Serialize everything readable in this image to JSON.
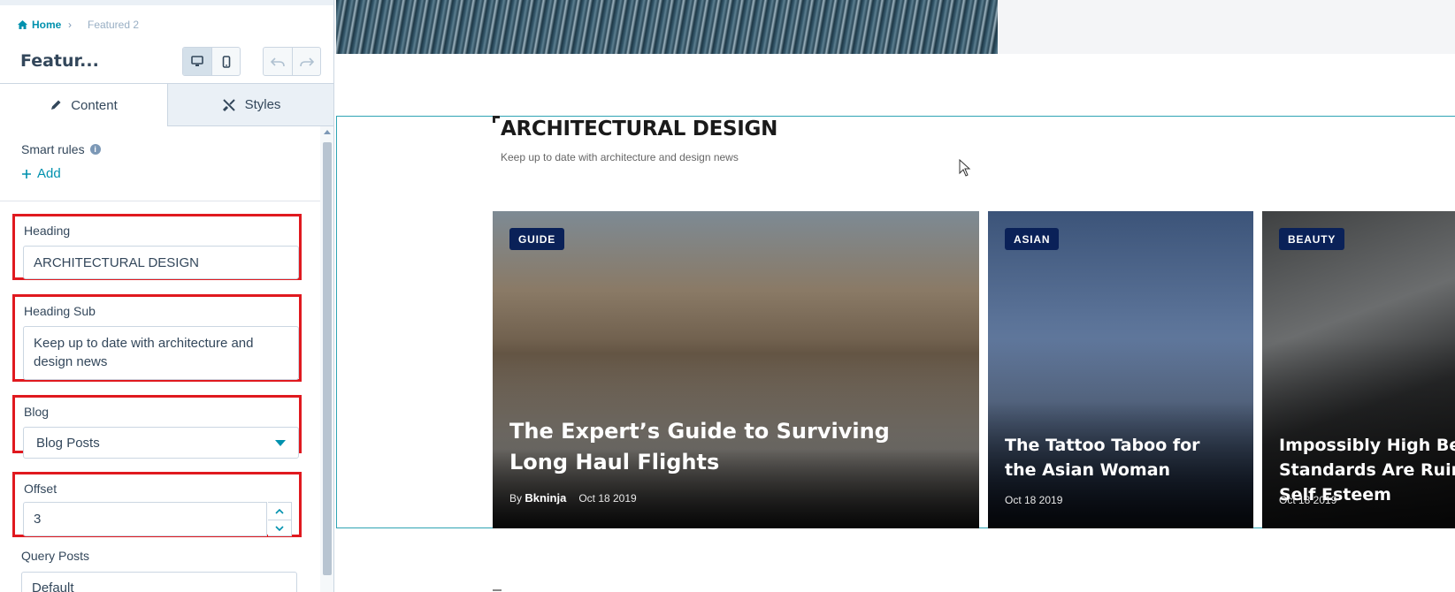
{
  "breadcrumb": {
    "home": "Home",
    "separator": "›",
    "current": "Featured 2"
  },
  "module_title": "Featur...",
  "toolbar": {
    "desktop_icon": "desktop-icon",
    "mobile_icon": "mobile-icon",
    "undo_icon": "undo-icon",
    "redo_icon": "redo-icon"
  },
  "tabs": [
    {
      "label": "Content",
      "icon": "pencil-icon",
      "active": true
    },
    {
      "label": "Styles",
      "icon": "brush-icon",
      "active": false
    }
  ],
  "smart_rules": {
    "label": "Smart rules",
    "info": "i",
    "add_label": "Add"
  },
  "fields": {
    "heading": {
      "label": "Heading",
      "value": "ARCHITECTURAL DESIGN"
    },
    "heading_sub": {
      "label": "Heading Sub",
      "value": "Keep up to date with architecture and design news"
    },
    "blog": {
      "label": "Blog",
      "value": "Blog Posts"
    },
    "offset": {
      "label": "Offset",
      "value": "3"
    },
    "query_posts": {
      "label": "Query Posts",
      "value": "Default"
    }
  },
  "preview": {
    "section_heading": "ARCHITECTURAL DESIGN",
    "section_sub": "Keep up to date with architecture and design news",
    "cards": [
      {
        "badge": "GUIDE",
        "title": "The Expert’s Guide to Surviving Long Haul Flights",
        "by": "By",
        "author": "Bkninja",
        "date": "Oct 18 2019"
      },
      {
        "badge": "ASIAN",
        "title": "The Tattoo Taboo for the Asian Woman",
        "date": "Oct 18 2019"
      },
      {
        "badge": "BEAUTY",
        "title": "Impossibly High Beauty Standards Are Ruining Self Esteem",
        "date": "Oct 18 2019"
      }
    ]
  },
  "colors": {
    "accent": "#0091ae",
    "highlight_border": "#e0191f",
    "badge": "#0a2158",
    "selection": "#2fa4b4"
  }
}
